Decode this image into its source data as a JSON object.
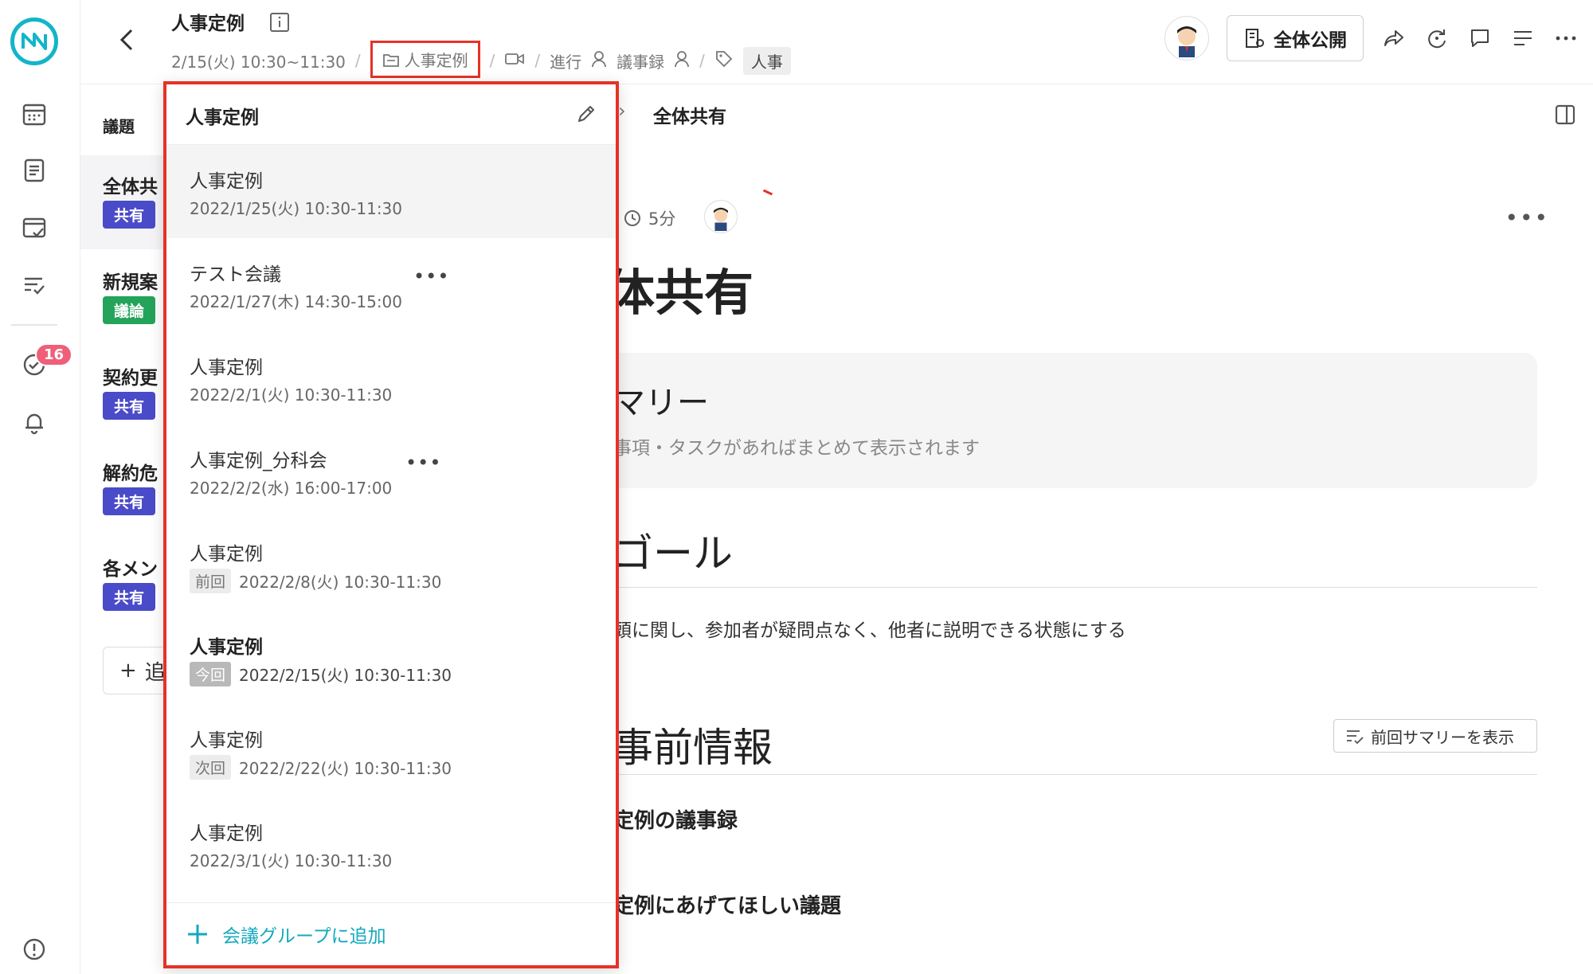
{
  "header": {
    "title": "人事定例",
    "datetime": "2/15(火) 10:30~11:30",
    "folder_label": "人事定例",
    "facilitator_label": "進行",
    "minutes_label": "議事録",
    "tag_label": "人事",
    "public_label": "全体公開"
  },
  "rail": {
    "notification_count": "16"
  },
  "agenda": {
    "heading": "議題",
    "items": [
      {
        "label": "全体共",
        "pill": "共有"
      },
      {
        "label": "新規案",
        "pill": "議論"
      },
      {
        "label": "契約更",
        "pill": "共有"
      },
      {
        "label": "解約危",
        "pill": "共有"
      },
      {
        "label": "各メン",
        "pill": "共有"
      }
    ],
    "add_label": "追"
  },
  "main": {
    "crumb": "全体共有",
    "duration": "5分",
    "title": "体共有",
    "summary_title": "マリー",
    "summary_desc": "事項・タスクがあればまとめて表示されます",
    "goal_title": "ゴール",
    "goal_text": "頭に関し、参加者が疑問点なく、他者に説明できる状態にする",
    "pre_title": "事前情報",
    "pre_button": "前回サマリーを表示",
    "pre_sub1": "定例の議事録",
    "pre_sub2": "定例にあげてほしい議題"
  },
  "dropdown": {
    "title": "人事定例",
    "items": [
      {
        "name": "人事定例",
        "date": "2022/1/25(火) 10:30-11:30"
      },
      {
        "name": "テスト会議",
        "date": "2022/1/27(木) 14:30-15:00"
      },
      {
        "name": "人事定例",
        "date": "2022/2/1(火) 10:30-11:30"
      },
      {
        "name": "人事定例_分科会",
        "date": "2022/2/2(水) 16:00-17:00"
      },
      {
        "name": "人事定例",
        "tag": "前回",
        "date": "2022/2/8(火) 10:30-11:30"
      },
      {
        "name": "人事定例",
        "tag": "今回",
        "date": "2022/2/15(火) 10:30-11:30"
      },
      {
        "name": "人事定例",
        "tag": "次回",
        "date": "2022/2/22(火) 10:30-11:30"
      },
      {
        "name": "人事定例",
        "date": "2022/3/1(火) 10:30-11:30"
      }
    ],
    "add_label": "会議グループに追加"
  },
  "colors": {
    "accent": "#13b5c8",
    "highlight_border": "#e53227",
    "share_pill": "#4a4bc8",
    "discuss_pill": "#24a35a",
    "badge": "#ef5f7a"
  }
}
